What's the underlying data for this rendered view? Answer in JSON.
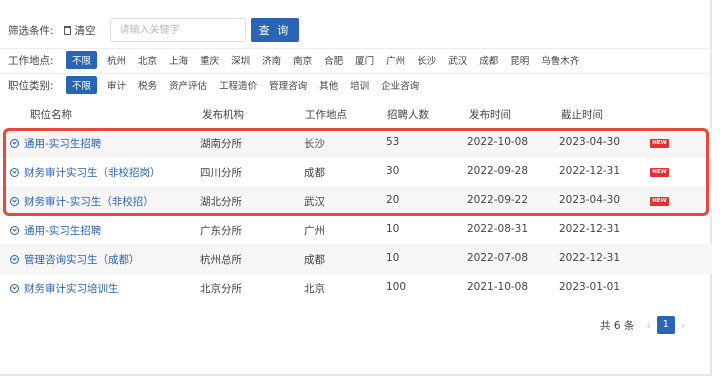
{
  "search": {
    "label": "筛选条件:",
    "clear_label": "清空",
    "placeholder": "请输入关键字",
    "button_label": "查 询"
  },
  "filters": {
    "location": {
      "label": "工作地点:",
      "options": [
        "不限",
        "杭州",
        "北京",
        "上海",
        "重庆",
        "深圳",
        "济南",
        "南京",
        "合肥",
        "厦门",
        "广州",
        "长沙",
        "武汉",
        "成都",
        "昆明",
        "乌鲁木齐"
      ],
      "active": "不限"
    },
    "category": {
      "label": "职位类别:",
      "options": [
        "不限",
        "审计",
        "税务",
        "资产评估",
        "工程造价",
        "管理咨询",
        "其他",
        "培训",
        "企业咨询"
      ],
      "active": "不限"
    }
  },
  "table": {
    "headers": [
      "职位名称",
      "发布机构",
      "工作地点",
      "招聘人数",
      "发布时间",
      "截止时间"
    ],
    "rows": [
      {
        "title": "通用-实习生招聘",
        "org": "湖南分所",
        "location": "长沙",
        "count": "53",
        "published": "2022-10-08",
        "deadline": "2023-04-30",
        "new": "NEW"
      },
      {
        "title": "财务审计实习生（非校招岗）",
        "org": "四川分所",
        "location": "成都",
        "count": "30",
        "published": "2022-09-28",
        "deadline": "2022-12-31",
        "new": "NEW"
      },
      {
        "title": "财务审计-实习生（非校招）",
        "org": "湖北分所",
        "location": "武汉",
        "count": "20",
        "published": "2022-09-22",
        "deadline": "2023-04-30",
        "new": "NEW"
      },
      {
        "title": "通用-实习生招聘",
        "org": "广东分所",
        "location": "广州",
        "count": "10",
        "published": "2022-08-31",
        "deadline": "2022-12-31",
        "new": ""
      },
      {
        "title": "管理咨询实习生（成都）",
        "org": "杭州总所",
        "location": "成都",
        "count": "10",
        "published": "2022-07-08",
        "deadline": "2022-12-31",
        "new": ""
      },
      {
        "title": "财务审计实习培训生",
        "org": "北京分所",
        "location": "北京",
        "count": "100",
        "published": "2021-10-08",
        "deadline": "2023-01-01",
        "new": ""
      }
    ]
  },
  "pagination": {
    "total_label": "共 6 条",
    "prev_icon": "‹",
    "next_icon": "›",
    "current_page": "1"
  },
  "colors": {
    "primary": "#2a64b5",
    "new_badge": "#e53030",
    "highlight_border": "#e8473c"
  }
}
